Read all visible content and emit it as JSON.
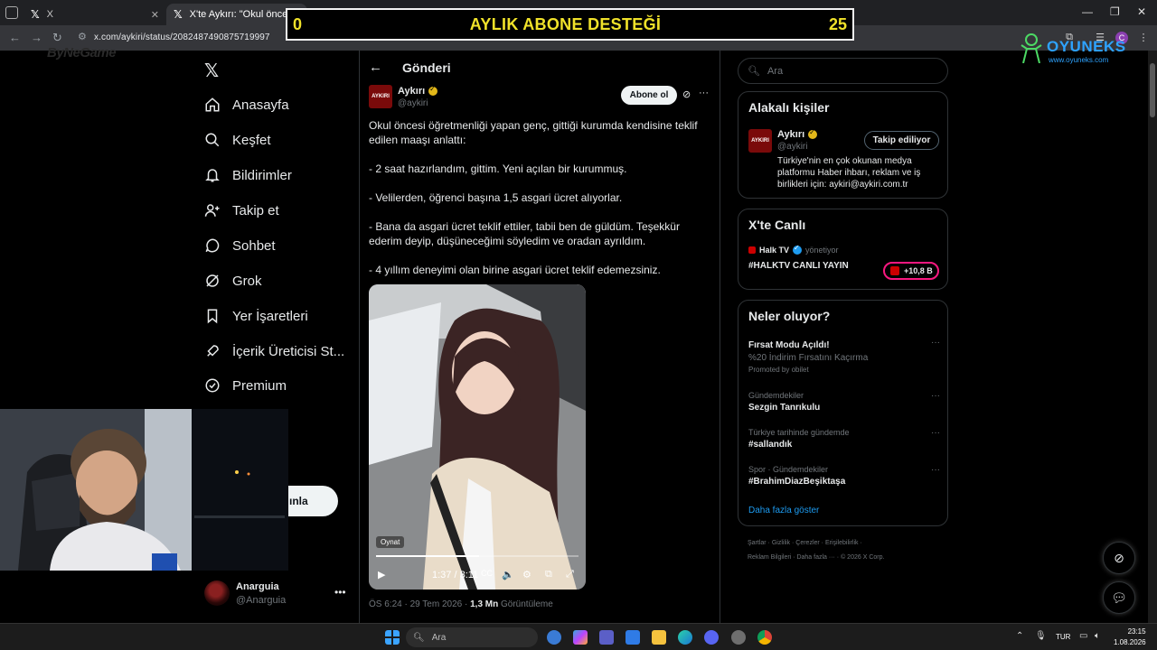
{
  "browser": {
    "tabs": [
      {
        "label": "X"
      },
      {
        "label": "X'te Aykırı: \"Okul öncesi öğret"
      }
    ],
    "url": "x.com/aykiri/status/2082487490875719997"
  },
  "overlay": {
    "min_value": "0",
    "title": "AYLIK ABONE DESTEĞİ",
    "max_value": "25",
    "brand_left": "ByNeGame",
    "brand_right": "OYUNEKS",
    "brand_right_sub": "www.oyuneks.com"
  },
  "sidebar": {
    "items": [
      {
        "label": "Anasayfa",
        "icon": "home-icon"
      },
      {
        "label": "Keşfet",
        "icon": "search-icon"
      },
      {
        "label": "Bildirimler",
        "icon": "bell-icon"
      },
      {
        "label": "Takip et",
        "icon": "add-user-icon"
      },
      {
        "label": "Sohbet",
        "icon": "chat-icon"
      },
      {
        "label": "Grok",
        "icon": "grok-icon"
      },
      {
        "label": "Yer İşaretleri",
        "icon": "bookmark-icon"
      },
      {
        "label": "İçerik Üreticisi St...",
        "icon": "rocket-icon"
      },
      {
        "label": "Premium",
        "icon": "verified-icon"
      }
    ],
    "more_label": "a",
    "post_label": "ınla",
    "account": {
      "name": "Anarguia",
      "handle": "@Anarguia"
    }
  },
  "post": {
    "page_title": "Gönderi",
    "author": {
      "name": "Aykırı",
      "handle": "@aykiri",
      "avatar_text": "AYKIRI"
    },
    "subscribe_label": "Abone ol",
    "paragraphs": [
      "Okul öncesi öğretmenliği yapan genç, gittiği kurumda kendisine teklif edilen maaşı anlattı:",
      "- 2 saat hazırlandım, gittim. Yeni açılan bir kurummuş.",
      "- Velilerden, öğrenci başına 1,5 asgari ücret alıyorlar.",
      "- Bana da asgari ücret teklif ettiler, tabii ben de güldüm. Teşekkür ederim deyip, düşüneceğimi söyledim ve oradan ayrıldım.",
      "- 4 yıllım deneyimi olan birine asgari ücret teklif edemezsiniz."
    ],
    "video": {
      "play_tooltip": "Oynat",
      "time": "1:37 / 3:11",
      "progress": 0.508
    },
    "meta": {
      "datetime": "ÖS 6:24 · 29 Tem 2026 · ",
      "views_count": "1,3 Mn",
      "views_label": " Görüntüleme"
    }
  },
  "right": {
    "search_placeholder": "Ara",
    "related": {
      "title": "Alakalı kişiler",
      "name": "Aykırı",
      "handle": "@aykiri",
      "follow_label": "Takip ediliyor",
      "bio": "Türkiye'nin en çok okunan medya platformu Haber ihbarı, reklam ve iş birlikleri için: aykiri@aykiri.com.tr"
    },
    "live": {
      "title": "X'te Canlı",
      "host": "Halk TV",
      "host_sub": "yönetiyor",
      "stream_title": "#HALKTV CANLI YAYIN",
      "listeners": "+10,8 B"
    },
    "trends": {
      "title": "Neler oluyor?",
      "items": [
        {
          "context": "",
          "title": "Fırsat Modu Açıldı!",
          "sub": "%20 İndirim Fırsatını Kaçırma",
          "promo": "Promoted by obilet"
        },
        {
          "context": "Gündemdekiler",
          "title": "Sezgin Tanrıkulu"
        },
        {
          "context": "Türkiye tarihinde gündemde",
          "title": "#sallandık"
        },
        {
          "context": "Spor · Gündemdekiler",
          "title": "#BrahimDiazBeşiktaşa"
        }
      ],
      "show_more": "Daha fazla göster"
    },
    "footer": {
      "line1": "Şartlar  ·  Gizlilik  ·  Çerezler  ·  Erişilebilirlik  ·",
      "line2": "Reklam Bilgileri  ·  Daha fazla ···  ·  © 2026 X Corp."
    }
  },
  "taskbar": {
    "search_placeholder": "Ara",
    "lang": "TUR",
    "time": "23:15",
    "date": "1.08.2026"
  },
  "colors": {
    "accent": "#1d9bf0",
    "banner_text": "#f0e22a",
    "live_border": "#f91880",
    "gold_badge": "#e2b719"
  }
}
